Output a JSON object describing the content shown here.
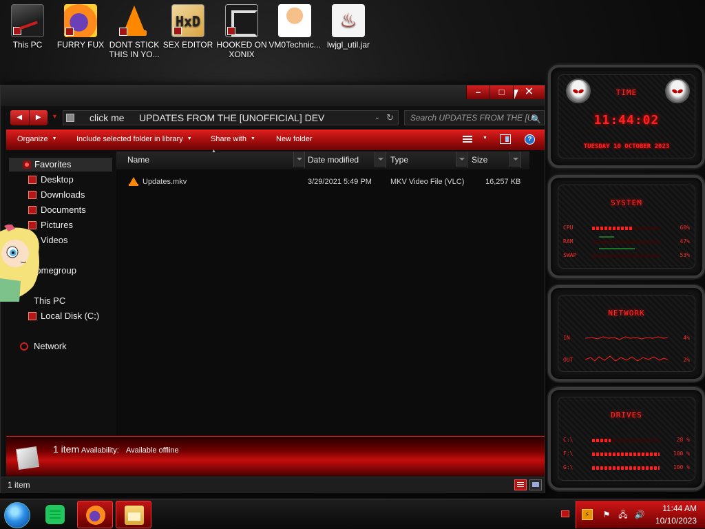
{
  "desktop": {
    "icons": [
      {
        "label": "This PC",
        "icon": "computer-icon"
      },
      {
        "label": "FURRY FUX",
        "icon": "firefox-icon"
      },
      {
        "label": "DONT STICK THIS IN YO...",
        "icon": "vlc-cone-icon"
      },
      {
        "label": "SEX EDITOR",
        "icon": "hxd-editor-icon"
      },
      {
        "label": "HOOKED ON XONIX",
        "icon": "xonix-game-icon"
      },
      {
        "label": "VM0Technic...",
        "icon": "doctor-avatar-icon"
      },
      {
        "label": "lwjgl_util.jar",
        "icon": "java-jar-icon"
      }
    ]
  },
  "explorer": {
    "caption_buttons": {
      "minimize": "–",
      "maximize": "□",
      "close": "✕"
    },
    "nav": {
      "back": "◀",
      "forward": "▶",
      "history": "▼"
    },
    "address": {
      "crumb_root": "click me",
      "crumb_folder": "UPDATES FROM THE [UNOFFICIAL] DEV",
      "dropdown": "⌄",
      "refresh": "↻"
    },
    "search": {
      "placeholder": "Search UPDATES FROM THE [U...",
      "icon": "🔍"
    },
    "commands": {
      "organize": "Organize",
      "include": "Include selected folder in library",
      "share": "Share with",
      "new_folder": "New folder",
      "caret": "▼",
      "help": "?"
    },
    "navpane": {
      "favorites": "Favorites",
      "desktop": "Desktop",
      "downloads": "Downloads",
      "documents": "Documents",
      "pictures": "Pictures",
      "videos": "Videos",
      "homegroup": "Homegroup",
      "this_pc": "This PC",
      "local_disk": "Local Disk (C:)",
      "network": "Network"
    },
    "columns": {
      "name": "Name",
      "date": "Date modified",
      "type": "Type",
      "size": "Size",
      "sort_indicator": "▲"
    },
    "files": [
      {
        "name": "Updates.mkv",
        "date": "3/29/2021 5:49 PM",
        "type": "MKV Video File (VLC)",
        "size": "16,257 KB"
      }
    ],
    "details": {
      "count": "1 item",
      "availability_label": "Availability:",
      "availability_value": "Available offline"
    },
    "status": {
      "items": "1 item"
    }
  },
  "gadgets": {
    "time": {
      "title": "TIME",
      "clock": "11:44:02",
      "date": "TUESDAY 10 OCTOBER 2023"
    },
    "system": {
      "title": "SYSTEM",
      "rows": [
        {
          "label": "CPU",
          "value": "60%",
          "level": 0.6
        },
        {
          "label": "RAM",
          "value": "47%",
          "level": 0.47
        },
        {
          "label": "SWAP",
          "value": "53%",
          "level": 0.53
        }
      ]
    },
    "network": {
      "title": "NETWORK",
      "rows": [
        {
          "label": "IN",
          "value": "4%"
        },
        {
          "label": "OUT",
          "value": "2%"
        }
      ]
    },
    "drives": {
      "title": "DRIVES",
      "rows": [
        {
          "label": "C:\\",
          "value": "28 %",
          "level": 0.28
        },
        {
          "label": "F:\\",
          "value": "100 %",
          "level": 1.0
        },
        {
          "label": "G:\\",
          "value": "100 %",
          "level": 1.0
        }
      ]
    }
  },
  "taskbar": {
    "apps": [
      "chat-app-icon",
      "firefox-icon",
      "file-explorer-icon"
    ],
    "tray": {
      "volume": "🔊",
      "flag": "⚑",
      "network": "🖧",
      "time": "11:44 AM",
      "date": "10/10/2023"
    }
  },
  "colors": {
    "accent": "#d01616",
    "accent_dark": "#6b0000",
    "gadget_red": "#ff2020"
  }
}
